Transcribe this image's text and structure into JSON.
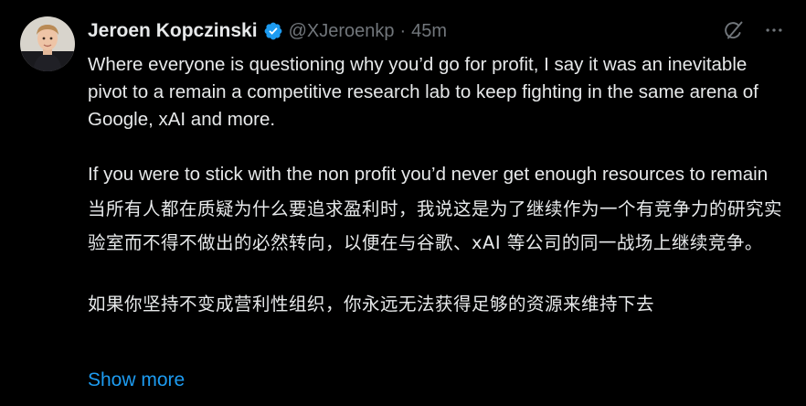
{
  "author": {
    "name": "Jeroen Kopczinski",
    "handle": "@XJeroenkp",
    "separator": "·",
    "time": "45m"
  },
  "icons": {
    "avatar": "profile-photo",
    "verified": "verified-badge-icon",
    "grok": "grok-icon",
    "more": "more-icon"
  },
  "colors": {
    "background": "#000000",
    "text": "#e7e9ea",
    "muted": "#71767b",
    "accent": "#1d9bf0"
  },
  "tweet": {
    "en_paragraphs": [
      "Where everyone is questioning why you’d go for profit, I say it was an inevitable pivot to a remain a competitive research lab to keep fighting in the same arena of Google, xAI and more.",
      "If you were to stick with the non profit you’d never get enough resources to remain"
    ],
    "zh_paragraphs": [
      "当所有人都在质疑为什么要追求盈利时，我说这是为了继续作为一个有竞争力的研究实验室而不得不做出的必然转向，以便在与谷歌、xAI 等公司的同一战场上继续竞争。",
      "如果你坚持不变成营利性组织，你永远无法获得足够的资源来维持下去"
    ],
    "show_more": "Show more"
  }
}
